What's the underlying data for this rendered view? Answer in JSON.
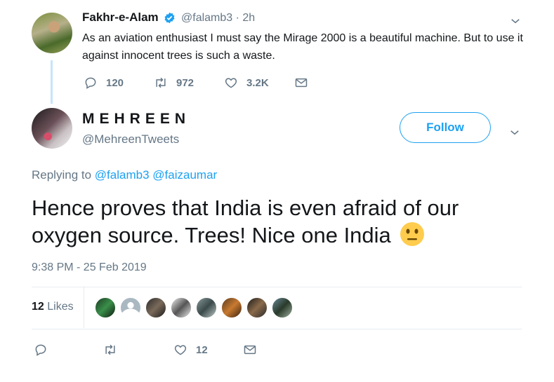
{
  "parent_tweet": {
    "name": "Fakhr-e-Alam",
    "handle_time": "@falamb3 · 2h",
    "text": "As an aviation enthusiast I must say the Mirage 2000 is a beautiful machine. But to use it against innocent trees is such a waste.",
    "replies": "120",
    "retweets": "972",
    "likes": "3.2K"
  },
  "main_tweet": {
    "name": "MEHREEN",
    "handle": "@MehreenTweets",
    "follow_label": "Follow",
    "replying_to_label": "Replying to",
    "replying_to_1": "@falamb3",
    "replying_to_2": "@faizaumar",
    "text": "Hence proves that India is even afraid of our oxygen source. Trees! Nice one India",
    "timestamp": "9:38 PM - 25 Feb 2019",
    "likes_count": "12",
    "likes_label": "Likes",
    "action_likes": "12"
  },
  "colors": {
    "accent": "#1da1f2",
    "muted": "#657786",
    "thread_line": "#c4e5fb",
    "divider": "#e6ecf0"
  },
  "icons": [
    "verified-icon",
    "reply-icon",
    "retweet-icon",
    "like-icon",
    "message-icon",
    "chevron-down-icon",
    "neutral-face-emoji"
  ]
}
